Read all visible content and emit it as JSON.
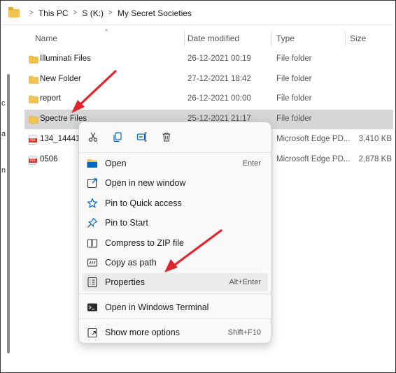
{
  "breadcrumb": {
    "items": [
      "This PC",
      "S (K:)",
      "My Secret Societies"
    ],
    "separator": ">"
  },
  "left_pane": {
    "fragments": [
      "c",
      "a",
      "n"
    ]
  },
  "columns": {
    "name": "Name",
    "date": "Date modified",
    "type": "Type",
    "size": "Size"
  },
  "files": [
    {
      "name": "Illuminati Files",
      "date": "26-12-2021 00:19",
      "type": "File folder",
      "size": "",
      "icon": "folder-icon",
      "selected": false
    },
    {
      "name": "New Folder",
      "date": "27-12-2021 18:42",
      "type": "File folder",
      "size": "",
      "icon": "folder-icon",
      "selected": false
    },
    {
      "name": "report",
      "date": "26-12-2021 00:00",
      "type": "File folder",
      "size": "",
      "icon": "folder-icon",
      "selected": false
    },
    {
      "name": "Spectre Files",
      "date": "25-12-2021 21:17",
      "type": "File folder",
      "size": "",
      "icon": "folder-icon",
      "selected": true
    },
    {
      "name": "134_14441C",
      "date": "",
      "type": "Microsoft Edge PD...",
      "size": "3,410 KB",
      "icon": "pdf-icon",
      "selected": false
    },
    {
      "name": "0506",
      "date": "",
      "type": "Microsoft Edge PD...",
      "size": "2,878 KB",
      "icon": "pdf-icon",
      "selected": false
    }
  ],
  "context_menu": {
    "quick_actions": [
      {
        "icon": "cut-icon"
      },
      {
        "icon": "copy-icon"
      },
      {
        "icon": "rename-icon"
      },
      {
        "icon": "delete-icon"
      }
    ],
    "items": [
      {
        "label": "Open",
        "shortcut": "Enter",
        "icon": "folder-open-icon"
      },
      {
        "label": "Open in new window",
        "shortcut": "",
        "icon": "new-window-icon"
      },
      {
        "label": "Pin to Quick access",
        "shortcut": "",
        "icon": "star-icon"
      },
      {
        "label": "Pin to Start",
        "shortcut": "",
        "icon": "pin-icon"
      },
      {
        "label": "Compress to ZIP file",
        "shortcut": "",
        "icon": "zip-icon"
      },
      {
        "label": "Copy as path",
        "shortcut": "",
        "icon": "copy-path-icon"
      },
      {
        "label": "Properties",
        "shortcut": "Alt+Enter",
        "icon": "properties-icon"
      },
      {
        "label": "Open in Windows Terminal",
        "shortcut": "",
        "icon": "terminal-icon"
      },
      {
        "label": "Show more options",
        "shortcut": "Shift+F10",
        "icon": "more-options-icon"
      }
    ],
    "hovered_item": "Properties"
  },
  "colors": {
    "accent": "#0067c0",
    "folder": "#f2c14e",
    "selection": "#d6d6d6",
    "arrow": "#e0242b"
  }
}
